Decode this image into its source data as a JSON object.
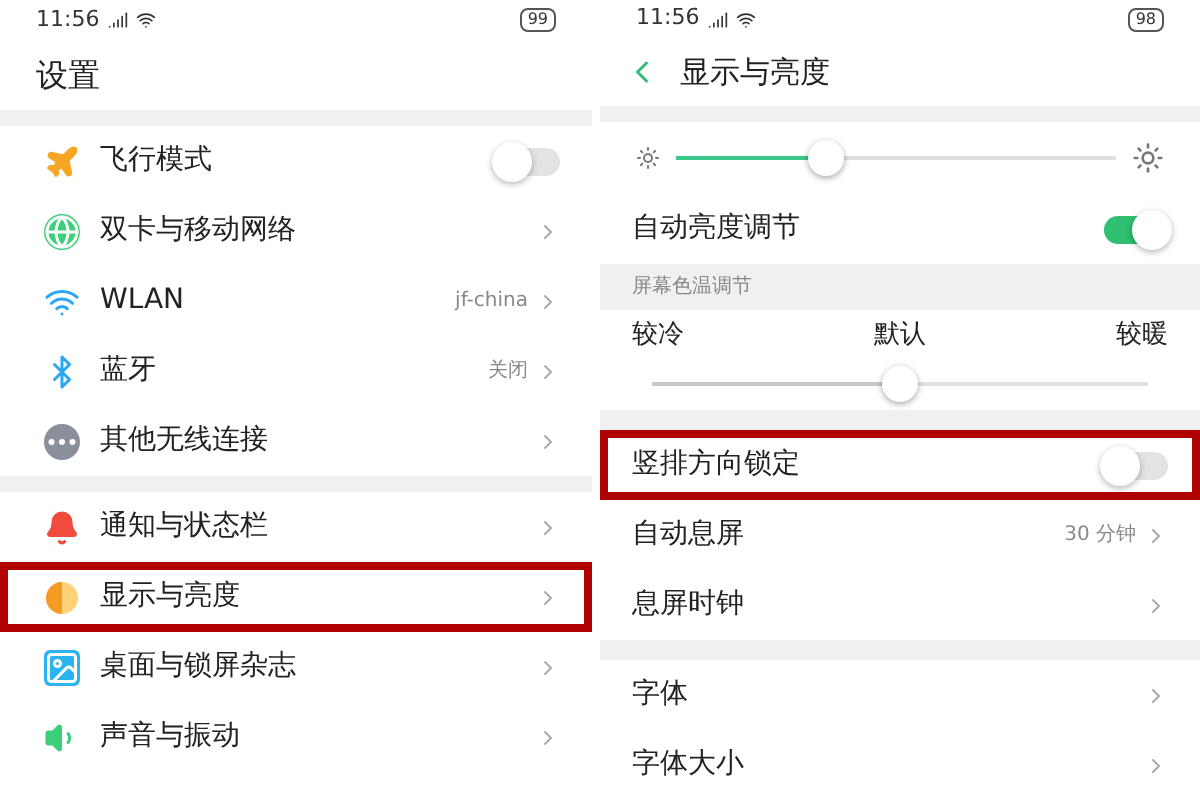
{
  "left_screen": {
    "status_bar": {
      "time": "11:56",
      "battery": "99"
    },
    "title": "设置",
    "groups": [
      [
        {
          "label": "飞行模式",
          "kind": "toggle",
          "on": false,
          "highlighted": false
        },
        {
          "label": "双卡与移动网络",
          "kind": "link",
          "highlighted": false
        },
        {
          "label": "WLAN",
          "kind": "link",
          "value": "jf-china",
          "highlighted": false
        },
        {
          "label": "蓝牙",
          "kind": "link",
          "value": "关闭",
          "highlighted": false
        },
        {
          "label": "其他无线连接",
          "kind": "link",
          "highlighted": false
        }
      ],
      [
        {
          "label": "通知与状态栏",
          "kind": "link",
          "highlighted": false
        },
        {
          "label": "显示与亮度",
          "kind": "link",
          "highlighted": true
        },
        {
          "label": "桌面与锁屏杂志",
          "kind": "link",
          "highlighted": false
        },
        {
          "label": "声音与振动",
          "kind": "link",
          "highlighted": false
        }
      ]
    ]
  },
  "right_screen": {
    "status_bar": {
      "time": "11:56",
      "battery": "98"
    },
    "title": "显示与亮度",
    "brightness": {
      "level": 0.34
    },
    "auto_brightness": {
      "label": "自动亮度调节",
      "on": true
    },
    "color_temperature": {
      "header": "屏幕色温调节",
      "labels": [
        "较冷",
        "默认",
        "较暖"
      ],
      "level": 0.5
    },
    "groups": [
      [
        {
          "label": "竖排方向锁定",
          "kind": "toggle",
          "on": false,
          "highlighted": true
        },
        {
          "label": "自动息屏",
          "kind": "link",
          "value": "30 分钟",
          "highlighted": false
        },
        {
          "label": "息屏时钟",
          "kind": "link",
          "highlighted": false
        }
      ],
      [
        {
          "label": "字体",
          "kind": "link",
          "highlighted": false
        },
        {
          "label": "字体大小",
          "kind": "link",
          "highlighted": false
        }
      ]
    ]
  }
}
